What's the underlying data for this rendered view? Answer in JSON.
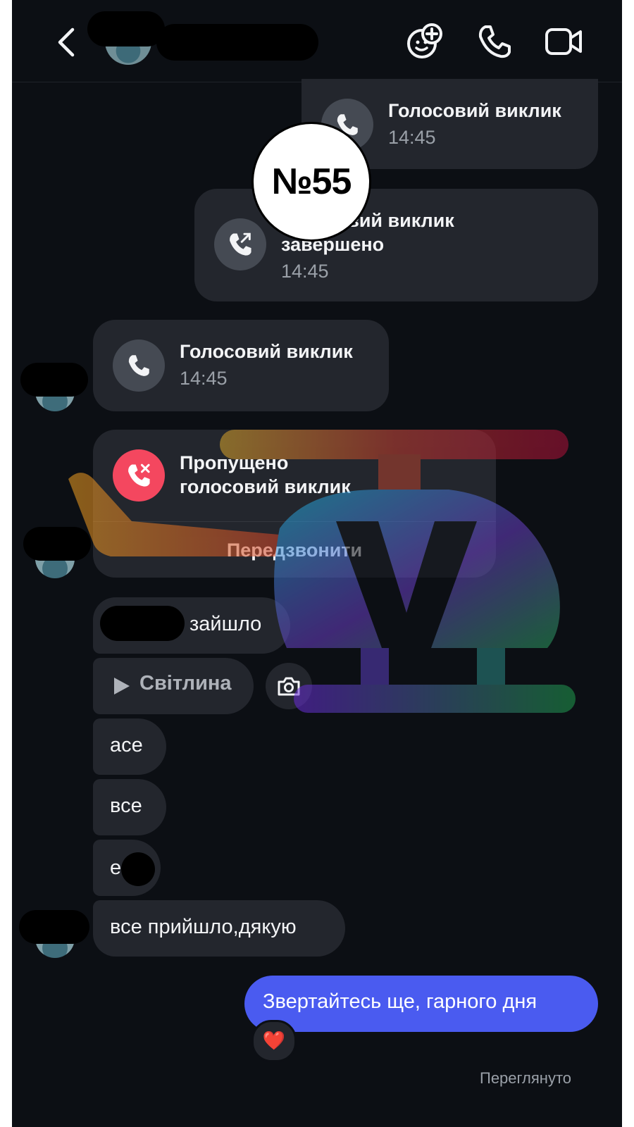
{
  "messages": {
    "call1_title": "Голосовий виклик",
    "call1_time": "14:45",
    "call2_title_line1": "Голосовий виклик",
    "call2_title_line2": "завершено",
    "call2_time": "14:45",
    "call3_title": "Голосовий виклик",
    "call3_time": "14:45",
    "missed_line1": "Пропущено",
    "missed_line2": "голосовий виклик",
    "callback_label": "Передзвонити",
    "msg1": "зайшло",
    "photo_label": "Світлина",
    "msg2": "асе",
    "msg3": "все",
    "msg4": "е",
    "msg5": "все прийшло,дякую",
    "own_msg": "Звертайтесь ще, гарного дня",
    "reaction": "❤️",
    "seen": "Переглянуто"
  },
  "badge": "№55",
  "colors": {
    "background": "#0c0f14",
    "bubble": "#23262d",
    "own_bubble": "#4a5bf0",
    "missed_icon": "#f4475f"
  },
  "icons": [
    "back-chevron-icon",
    "sticker-add-icon",
    "phone-icon",
    "video-camera-icon",
    "phone-outgoing-icon",
    "phone-missed-icon",
    "play-icon",
    "camera-icon"
  ]
}
